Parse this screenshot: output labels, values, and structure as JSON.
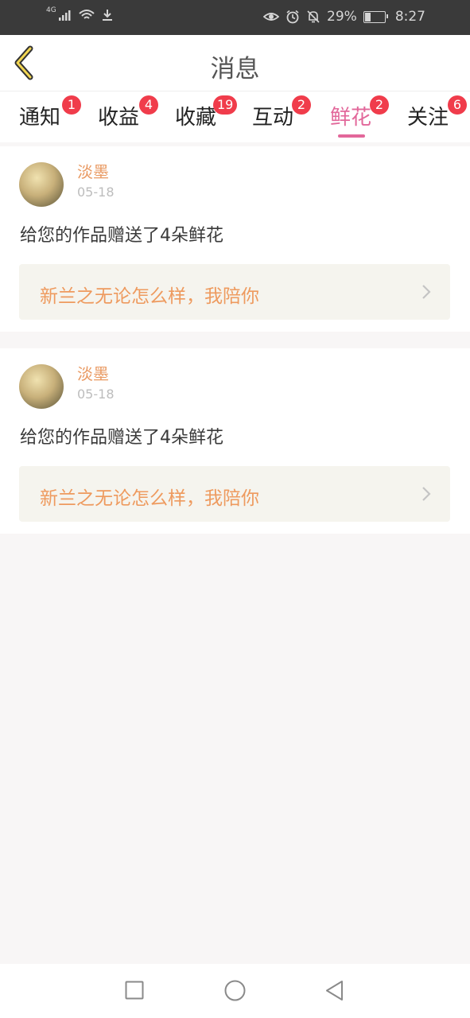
{
  "status_bar": {
    "network": "4G",
    "battery_percent": "29%",
    "time": "8:27"
  },
  "header": {
    "title": "消息"
  },
  "tabs": [
    {
      "label": "通知",
      "badge": "1",
      "active": false
    },
    {
      "label": "收益",
      "badge": "4",
      "active": false
    },
    {
      "label": "收藏",
      "badge": "19",
      "active": false
    },
    {
      "label": "互动",
      "badge": "2",
      "active": false
    },
    {
      "label": "鲜花",
      "badge": "2",
      "active": true
    },
    {
      "label": "关注",
      "badge": "6",
      "active": false
    }
  ],
  "messages": [
    {
      "username": "淡墨",
      "date": "05-18",
      "text": "给您的作品赠送了4朵鲜花",
      "work_title": "新兰之无论怎么样，我陪你"
    },
    {
      "username": "淡墨",
      "date": "05-18",
      "text": "给您的作品赠送了4朵鲜花",
      "work_title": "新兰之无论怎么样，我陪你"
    }
  ],
  "colors": {
    "accent_pink": "#e2679a",
    "badge_red": "#f03c4b",
    "username_orange": "#e99a63",
    "link_bg": "#f5f4ee"
  }
}
